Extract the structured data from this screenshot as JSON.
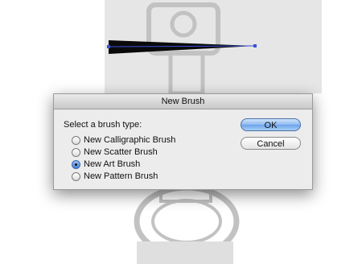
{
  "dialog": {
    "title": "New Brush",
    "prompt": "Select a brush type:",
    "options": [
      {
        "label": "New Calligraphic Brush",
        "selected": false
      },
      {
        "label": "New Scatter Brush",
        "selected": false
      },
      {
        "label": "New Art Brush",
        "selected": true
      },
      {
        "label": "New Pattern Brush",
        "selected": false
      }
    ],
    "ok_label": "OK",
    "cancel_label": "Cancel"
  },
  "colors": {
    "default_button": "#8fbaf0",
    "selected_radio": "#3f7fd6",
    "stroke_fill": "#0a0a0a",
    "stroke_anchor": "#3a4fd8"
  }
}
